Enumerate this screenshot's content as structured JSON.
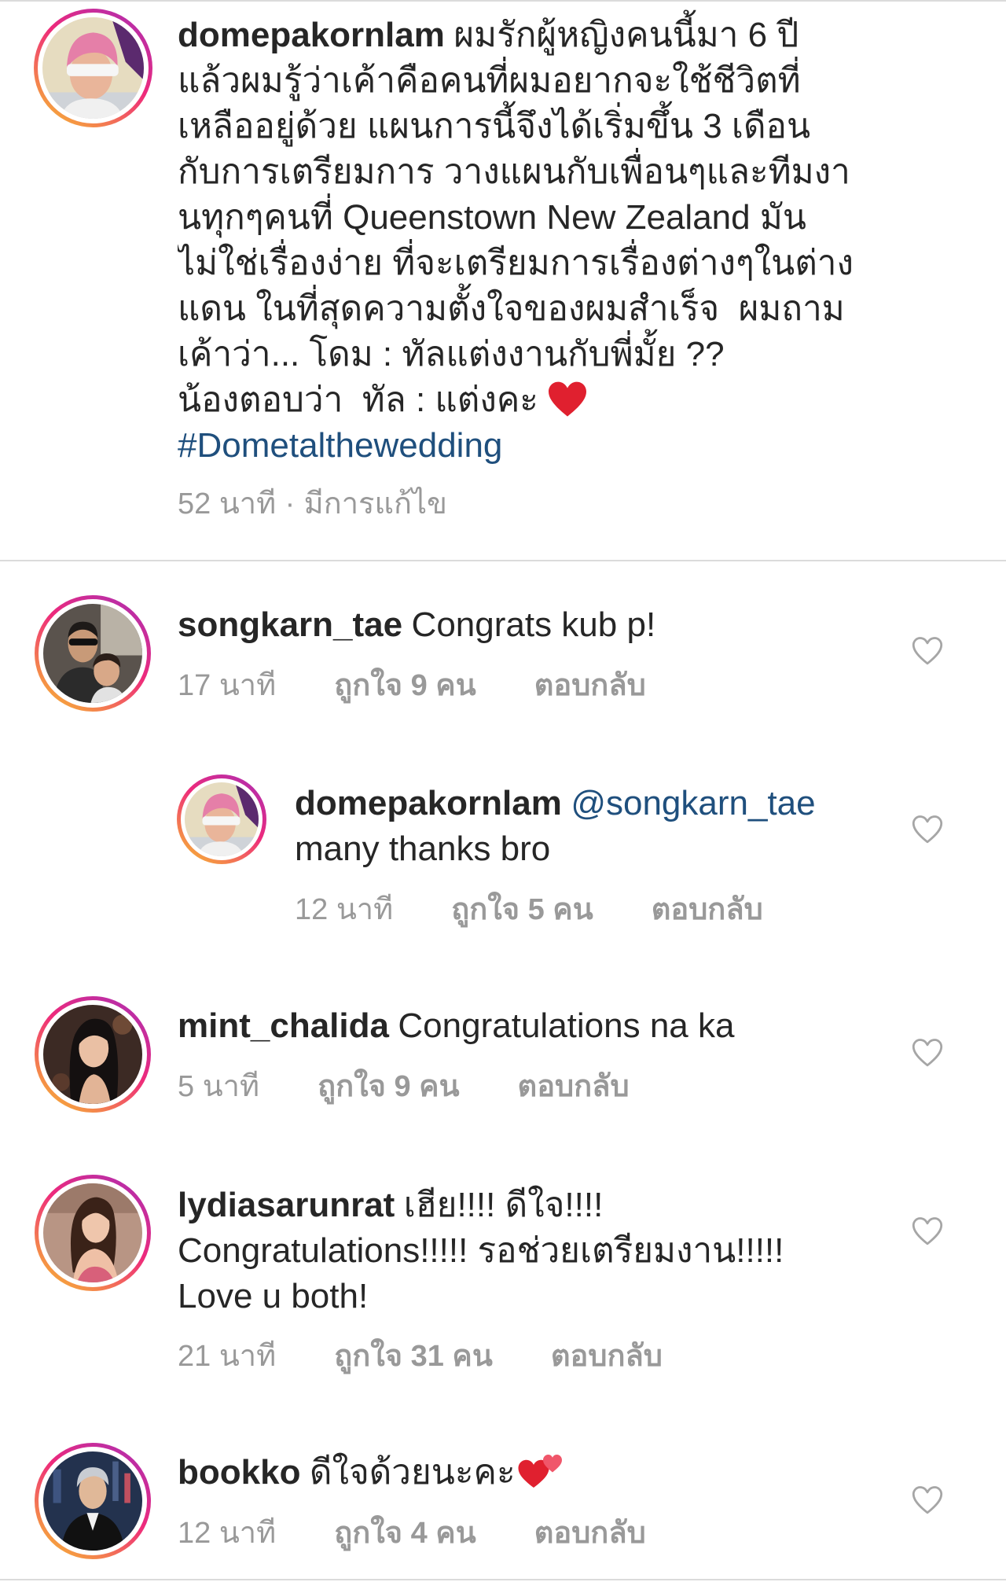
{
  "colors": {
    "text": "#262626",
    "meta": "#999999",
    "link": "#1f4f7d",
    "divider": "#dbdbdb",
    "like_icon": "#a6a6a6",
    "story_ring": [
      "#f7b733",
      "#ee2a7b",
      "#a62fb8"
    ],
    "emoji_heart": "#e0202f"
  },
  "icons": {
    "like_button": "heart-outline-icon",
    "avatar": "profile-photo"
  },
  "post": {
    "author": {
      "username": "domepakornlam"
    },
    "caption_lines": [
      "ผมรักผู้หญิงคนนี้มา 6 ปี",
      "แล้วผมรู้ว่าเค้าคือคนที่ผมอยากจะใช้ชีวิตที่",
      "เหลืออยู่ด้วย แผนการนี้จึงได้เริ่มขึ้น 3 เดือน",
      "กับการเตรียมการ วางแผนกับเพื่อนๆและทีมงา",
      "นทุกๆคนที่ Queenstown New Zealand มัน",
      "ไม่ใช่เรื่องง่าย ที่จะเตรียมการเรื่องต่างๆในต่าง",
      "แดน ในที่สุดความตั้งใจของผมสำเร็จ  ผมถาม",
      "เค้าว่า... โดม : ทัลแต่งงานกับพี่มั้ย ??",
      "น้องตอบว่า  ทัล : แต่งคะ"
    ],
    "caption_emoji_icon": "red-heart-emoji-icon",
    "hashtag": "#Dometalthewedding",
    "time": "52 นาที",
    "separator": "·",
    "edited_label": "มีการแก้ไข"
  },
  "comments": [
    {
      "username": "songkarn_tae",
      "lines": [
        "Congrats kub p!"
      ],
      "time": "17 นาที",
      "likes_label": "ถูกใจ 9 คน",
      "reply_label": "ตอบกลับ",
      "replies": [
        {
          "username": "domepakornlam",
          "mention": "@songkarn_tae",
          "lines": [
            "many thanks bro"
          ],
          "time": "12 นาที",
          "likes_label": "ถูกใจ 5 คน",
          "reply_label": "ตอบกลับ"
        }
      ]
    },
    {
      "username": "mint_chalida",
      "lines": [
        "Congratulations na ka"
      ],
      "time": "5 นาที",
      "likes_label": "ถูกใจ 9 คน",
      "reply_label": "ตอบกลับ"
    },
    {
      "username": "lydiasarunrat",
      "lines": [
        "เฮีย!!!! ดีใจ!!!!",
        "Congratulations!!!!! รอช่วยเตรียมงาน!!!!!",
        "Love u both!"
      ],
      "time": "21 นาที",
      "likes_label": "ถูกใจ 31 คน",
      "reply_label": "ตอบกลับ"
    },
    {
      "username": "bookko",
      "lines": [
        "ดีใจด้วยนะคะ"
      ],
      "emoji_icon": "two-hearts-emoji-icon",
      "time": "12 นาที",
      "likes_label": "ถูกใจ 4 คน",
      "reply_label": "ตอบกลับ"
    }
  ]
}
